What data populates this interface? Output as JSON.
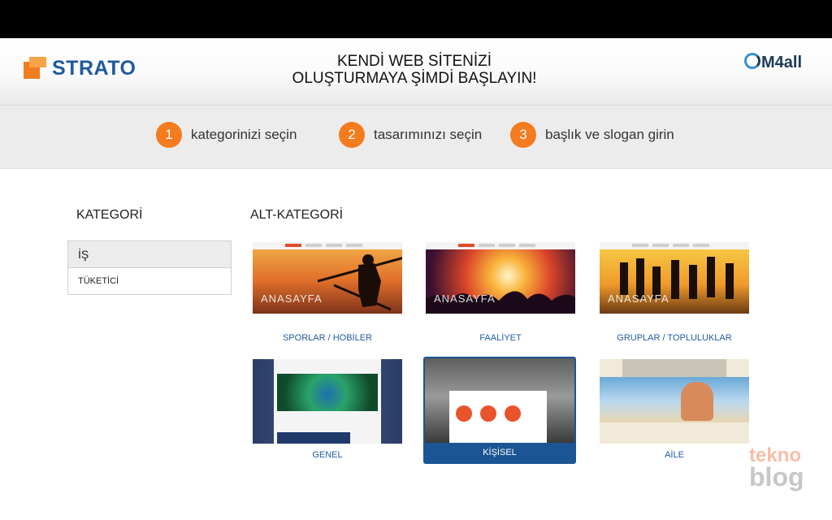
{
  "header": {
    "logo_text": "STRATO",
    "headline_line1": "KENDİ WEB SİTENİZİ",
    "headline_line2": "OLUŞTURMAYA ŞİMDİ BAŞLAYIN!",
    "partner_logo": "M4all"
  },
  "steps": [
    {
      "number": "1",
      "label": "kategorinizi seçin"
    },
    {
      "number": "2",
      "label": "tasarımınızı seçin"
    },
    {
      "number": "3",
      "label": "başlık ve slogan girin"
    }
  ],
  "category": {
    "title": "KATEGORİ",
    "items": [
      {
        "label": "İŞ",
        "selected": true
      },
      {
        "label": "TÜKETİCİ",
        "selected": false
      }
    ]
  },
  "subcategory": {
    "title": "ALT-KATEGORİ",
    "cards": [
      {
        "caption": "SPORLAR / HOBİLER",
        "banner": "ANASAYFA",
        "selected": false
      },
      {
        "caption": "FAALİYET",
        "banner": "ANASAYFA",
        "selected": false
      },
      {
        "caption": "GRUPLAR / TOPLULUKLAR",
        "banner": "ANASAYFA",
        "selected": false
      },
      {
        "caption": "GENEL",
        "selected": false
      },
      {
        "caption": "KİŞİSEL",
        "selected": true
      },
      {
        "caption": "AİLE",
        "selected": false
      }
    ]
  },
  "watermark": {
    "line1": "tekno",
    "line2": "blog"
  },
  "colors": {
    "accent_orange": "#f57b1f",
    "brand_blue": "#1f5a9e",
    "selected_blue": "#1c5593"
  }
}
